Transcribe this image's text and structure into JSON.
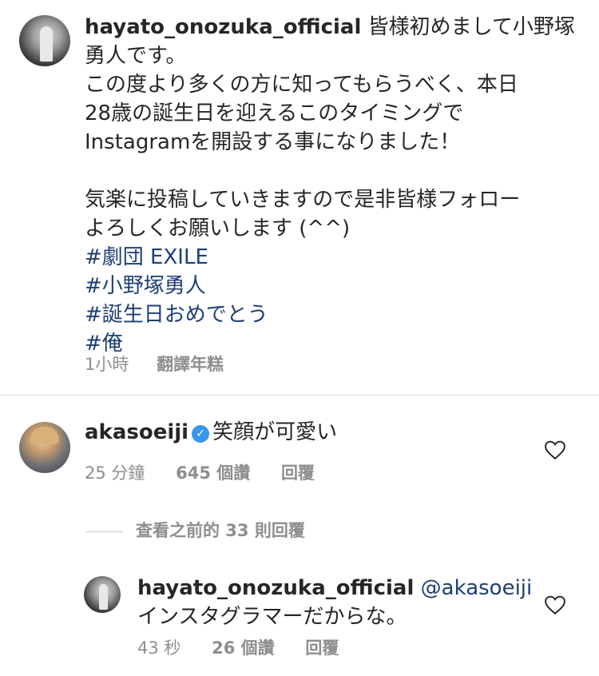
{
  "post": {
    "username": "hayato_onozuka_official",
    "caption_lines": [
      "皆様初めまして小野塚",
      "勇人です。",
      "この度より多くの方に知ってもらうべく、本日",
      "28歳の誕生日を迎えるこのタイミングで",
      "Instagramを開設する事になりました！",
      "",
      "気楽に投稿していきますので是非皆様フォロー",
      "よろしくお願いします (^^)"
    ],
    "hashtags": [
      "#劇団 EXILE",
      "#小野塚勇人",
      "#誕生日おめでとう",
      "#俺"
    ],
    "time": "1小時",
    "translate_label": "翻譯年糕"
  },
  "comment": {
    "username": "akasoeiji",
    "text": "笑顔が可愛い",
    "time": "25 分鐘",
    "likes": "645 個讚",
    "reply_label": "回覆"
  },
  "view_previous": "查看之前的 33 則回覆",
  "reply": {
    "username": "hayato_onozuka_official",
    "mention": "@akasoeiji",
    "text": "インスタグラマーだからな。",
    "time": "43 秒",
    "likes": "26 個讚",
    "reply_label": "回覆"
  },
  "colors": {
    "hashtag": "#1d3f73",
    "meta": "#8e8e8e",
    "verified": "#3897f0"
  },
  "icons": [
    "heart-icon",
    "verified-badge-icon"
  ]
}
